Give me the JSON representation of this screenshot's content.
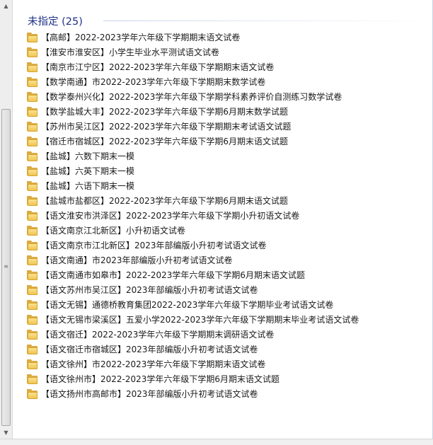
{
  "group": {
    "title": "未指定 (25)"
  },
  "items": [
    {
      "label": "【高邮】2022-2023学年六年级下学期期末语文试卷"
    },
    {
      "label": "【淮安市淮安区】小学生毕业水平测试语文试卷"
    },
    {
      "label": "【南京市江宁区】2022-2023学年六年级下学期期末语文试卷"
    },
    {
      "label": "【数学南通】市2022-2023学年六年级下学期期末数学试卷"
    },
    {
      "label": "【数学泰州兴化】2022-2023学年六年级下学期学科素养评价自测练习数学试卷"
    },
    {
      "label": "【数学盐城大丰】2022-2023学年六年级下学期6月期末数学试题"
    },
    {
      "label": "【苏州市吴江区】2022-2023学年六年级下学期期末考试语文试题"
    },
    {
      "label": "【宿迁市宿城区】2022-2023学年六年级下学期6月期末语文试题"
    },
    {
      "label": "【盐城】六数下期末一模"
    },
    {
      "label": "【盐城】六英下期末一模"
    },
    {
      "label": "【盐城】六语下期末一模"
    },
    {
      "label": "【盐城市盐都区】2022-2023学年六年级下学期6月期末语文试题"
    },
    {
      "label": "【语文淮安市洪泽区】2022-2023学年六年级下学期小升初语文试卷"
    },
    {
      "label": "【语文南京江北新区】小升初语文试卷"
    },
    {
      "label": "【语文南京市江北新区】2023年部编版小升初考试语文试卷"
    },
    {
      "label": "【语文南通】市2023年部编版小升初考试语文试卷"
    },
    {
      "label": "【语文南通市如皋市】2022-2023学年六年级下学期6月期末语文试题"
    },
    {
      "label": "【语文苏州市吴江区】2023年部编版小升初考试语文试卷"
    },
    {
      "label": "【语文无锡】通德桥教育集团2022-2023学年六年级下学期毕业考试语文试卷"
    },
    {
      "label": "【语文无锡市梁溪区】五爱小学2022-2023学年六年级下学期期末毕业考试语文试卷"
    },
    {
      "label": "【语文宿迁】2022-2023学年六年级下学期期末调研语文试卷"
    },
    {
      "label": "【语文宿迁市宿城区】2023年部编版小升初考试语文试卷"
    },
    {
      "label": "【语文徐州】市2022-2023学年六年级下学期期末语文试卷"
    },
    {
      "label": "【语文徐州市】2022-2023学年六年级下学期6月期末语文试题"
    },
    {
      "label": "【语文扬州市高邮市】2023年部编版小升初考试语文试卷"
    }
  ]
}
